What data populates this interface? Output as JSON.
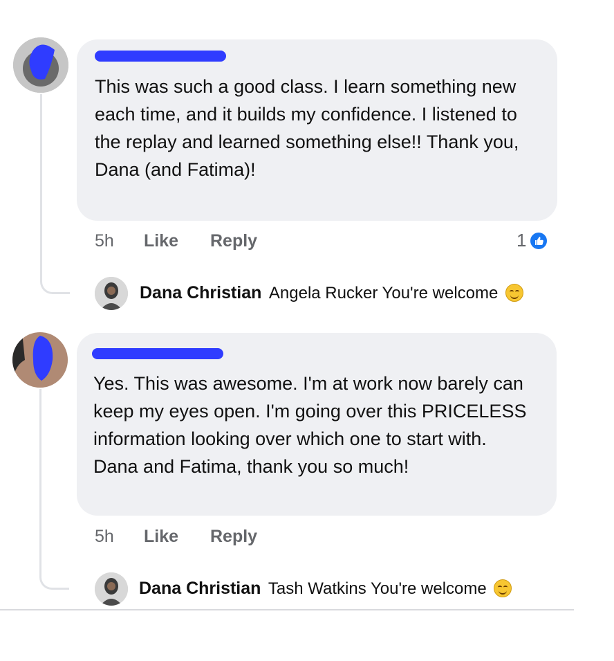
{
  "comment1": {
    "text": "This was such a good class. I learn something new each time, and it builds my confidence. I listened to the replay and learned something else!! Thank you, Dana (and Fatima)!",
    "time": "5h",
    "like_label": "Like",
    "reply_label": "Reply",
    "reaction_count": "1",
    "reply": {
      "author": "Dana Christian",
      "text": "Angela Rucker You're welcome"
    }
  },
  "comment2": {
    "text": "Yes. This was awesome. I'm at work now barely can keep my eyes open.  I'm going over this PRICELESS information looking over which one to start with. Dana and Fatima, thank you so much!",
    "time": "5h",
    "like_label": "Like",
    "reply_label": "Reply",
    "reply": {
      "author": "Dana Christian",
      "text": "Tash Watkins You're welcome"
    }
  },
  "colors": {
    "redaction": "#2f3cff",
    "like_badge": "#1877f2",
    "bubble": "#eff0f3",
    "meta_text": "#65676b"
  },
  "icons": {
    "reaction": "like-reaction-icon",
    "emoji": "smiling-face-emoji-icon"
  }
}
